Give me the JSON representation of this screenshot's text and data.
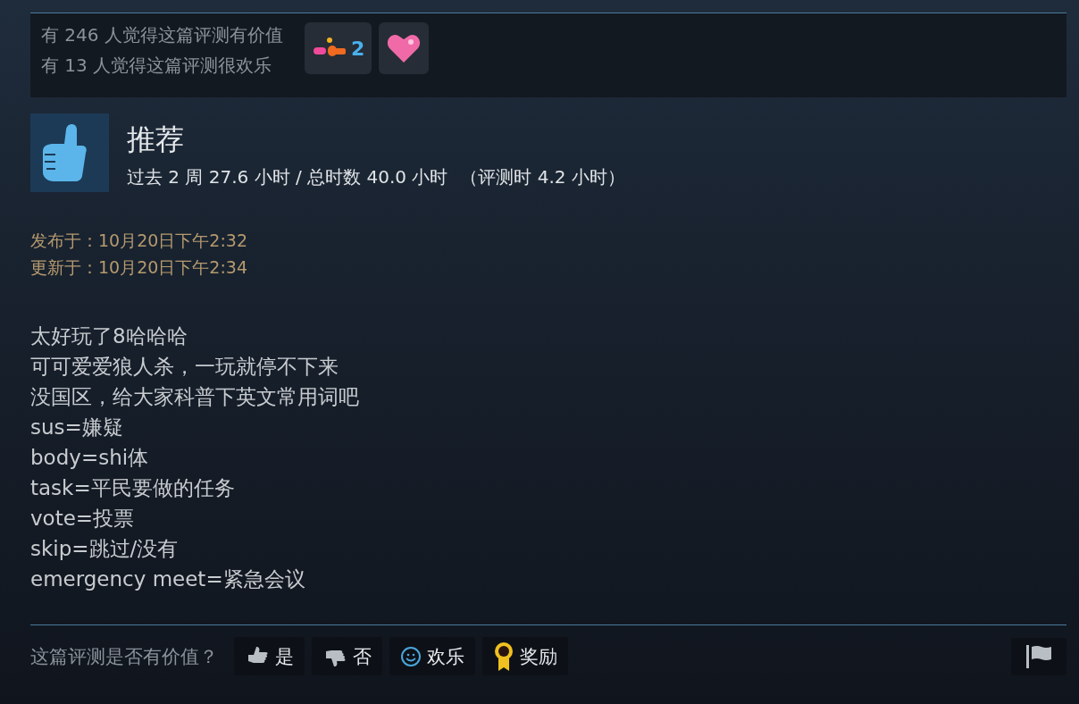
{
  "votes": {
    "helpful": "有 246 人觉得这篇评测有价值",
    "funny": "有 13 人觉得这篇评测很欢乐"
  },
  "awards": [
    {
      "kind": "flowers",
      "count": "2"
    },
    {
      "kind": "heart"
    }
  ],
  "recommendation": {
    "title": "推荐",
    "hours": "过去 2 周 27.6 小时 / 总时数 40.0 小时",
    "review_hours": "（评测时 4.2 小时）"
  },
  "dates": [
    "发布于：10月20日下午2:32",
    "更新于：10月20日下午2:34"
  ],
  "body": [
    "太好玩了8哈哈哈",
    "可可爱爱狼人杀，一玩就停不下来",
    "没国区，给大家科普下英文常用词吧",
    "sus=嫌疑",
    "body=shi体",
    "task=平民要做的任务",
    "vote=投票",
    "skip=跳过/没有",
    "emergency meet=紧急会议"
  ],
  "footer": {
    "question": "这篇评测是否有价值？",
    "buttons": [
      {
        "kind": "yes",
        "label": "是"
      },
      {
        "kind": "no",
        "label": "否"
      },
      {
        "kind": "funny",
        "label": "欢乐"
      },
      {
        "kind": "award",
        "label": "奖励"
      }
    ]
  }
}
